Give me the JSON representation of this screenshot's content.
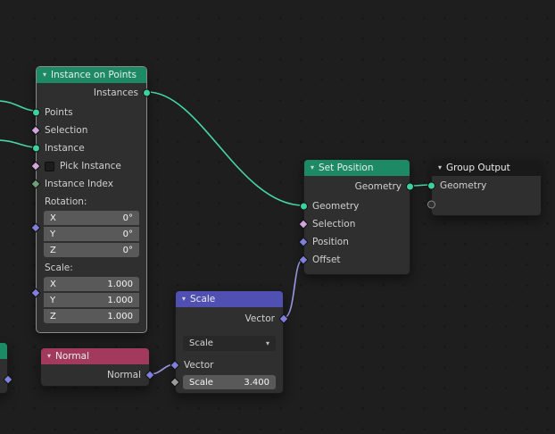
{
  "canvas": {
    "background": "#1e1e1e",
    "dot_color": "#141414"
  },
  "icons": {
    "collapse_chevron": "▾",
    "dropdown_chevron": "▾"
  },
  "colors": {
    "header_geometry": "#1d8a66",
    "header_vector": "#5050b2",
    "header_input": "#a23a5e",
    "header_output": "#191919",
    "socket_geometry": "#3dd0a0",
    "socket_vector": "#7f7fdc",
    "socket_boolean": "#d0a6dc",
    "socket_integer": "#6f9f76",
    "socket_float": "#9a9a9a",
    "wire_geometry": "#46d7a5",
    "wire_vector": "#9a9ae8"
  },
  "nodes": {
    "instance_on_points": {
      "title": "Instance on Points",
      "output_label": "Instances",
      "input_points": "Points",
      "input_selection": "Selection",
      "input_instance": "Instance",
      "input_pick_instance": "Pick Instance",
      "input_instance_index": "Instance Index",
      "rotation_label": "Rotation:",
      "rotation_fields": [
        {
          "axis": "X",
          "value": "0°"
        },
        {
          "axis": "Y",
          "value": "0°"
        },
        {
          "axis": "Z",
          "value": "0°"
        }
      ],
      "scale_label": "Scale:",
      "scale_fields": [
        {
          "axis": "X",
          "value": "1.000"
        },
        {
          "axis": "Y",
          "value": "1.000"
        },
        {
          "axis": "Z",
          "value": "1.000"
        }
      ]
    },
    "set_position": {
      "title": "Set Position",
      "output_label": "Geometry",
      "input_geometry": "Geometry",
      "input_selection": "Selection",
      "input_position": "Position",
      "input_offset": "Offset"
    },
    "group_output": {
      "title": "Group Output",
      "input_geometry": "Geometry"
    },
    "scale": {
      "title": "Scale",
      "output_label": "Vector",
      "mode_dropdown": "Scale",
      "input_vector": "Vector",
      "scale_field_label": "Scale",
      "scale_field_value": "3.400"
    },
    "normal": {
      "title": "Normal",
      "output_label": "Normal"
    }
  }
}
